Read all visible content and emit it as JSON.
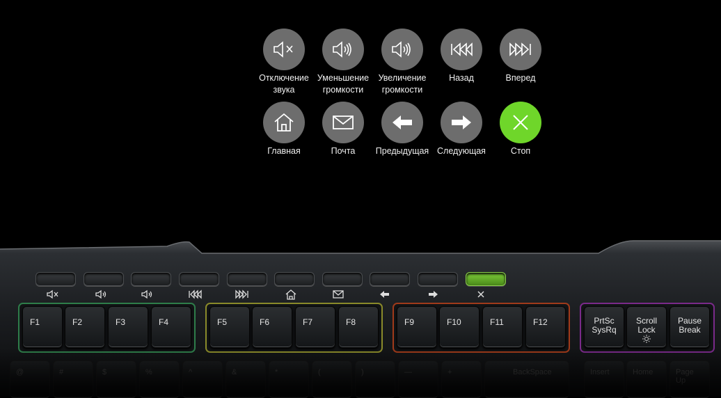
{
  "shortcuts": [
    {
      "icon": "mute-icon",
      "label": "Отключение\nзвука",
      "color": "#6d6d6d"
    },
    {
      "icon": "volume-down-icon",
      "label": "Уменьшение\nгромкости",
      "color": "#6d6d6d"
    },
    {
      "icon": "volume-up-icon",
      "label": "Увеличение\nгромкости",
      "color": "#6d6d6d"
    },
    {
      "icon": "rewind-icon",
      "label": "Назад",
      "color": "#6d6d6d"
    },
    {
      "icon": "fast-forward-icon",
      "label": "Вперед",
      "color": "#6d6d6d"
    },
    {
      "icon": "home-icon",
      "label": "Главная",
      "color": "#6d6d6d"
    },
    {
      "icon": "mail-icon",
      "label": "Почта",
      "color": "#6d6d6d"
    },
    {
      "icon": "arrow-left-icon",
      "label": "Предыдущая",
      "color": "#6d6d6d"
    },
    {
      "icon": "arrow-right-icon",
      "label": "Следующая",
      "color": "#6d6d6d"
    },
    {
      "icon": "close-icon",
      "label": "Стоп",
      "color": "#6fd62a"
    }
  ],
  "keyboard": {
    "fkeys": [
      "F1",
      "F2",
      "F3",
      "F4",
      "F5",
      "F6",
      "F7",
      "F8",
      "F9",
      "F10",
      "F11",
      "F12"
    ],
    "special": [
      "PrtSc\nSysRq",
      "Scroll\nLock",
      "Pause\nBreak"
    ],
    "row2": [
      "@",
      "#",
      "$",
      "%",
      "^",
      "&",
      "*",
      "(",
      ")",
      "—",
      "+",
      "BackSpace",
      "Insert",
      "Home",
      "Page\nUp"
    ],
    "group_colors": [
      "#2e7d4a",
      "#8a8a2a",
      "#a03a1a",
      "#7a2a8a"
    ]
  }
}
